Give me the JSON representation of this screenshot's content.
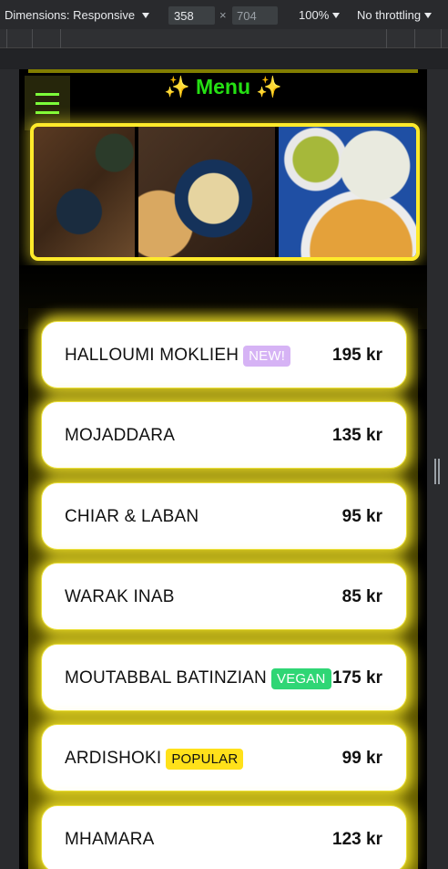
{
  "devtools": {
    "dimensions_label": "Dimensions: Responsive",
    "width_value": "358",
    "height_value": "704",
    "times": "×",
    "zoom": "100%",
    "throttling": "No throttling"
  },
  "page": {
    "title_left_sparkle": "✨",
    "title": "Menu",
    "title_right_sparkle": "✨"
  },
  "menu": {
    "items": [
      {
        "name": "HALLOUMI MOKLIEH",
        "badge": "NEW!",
        "price": "195 kr"
      },
      {
        "name": "MOJADDARA",
        "price": "135 kr"
      },
      {
        "name": "CHIAR & LABAN",
        "price": "95 kr"
      },
      {
        "name": "WARAK INAB",
        "price": "85 kr"
      },
      {
        "name": "MOUTABBAL BATINZIAN",
        "badge": "VEGAN",
        "price": "175 kr"
      },
      {
        "name": "ARDISHOKI",
        "badge": "POPULAR",
        "price": "99 kr"
      },
      {
        "name": "MHAMARA",
        "price": "123 kr"
      }
    ]
  },
  "colors": {
    "accent_yellow": "#ffea2b",
    "title_green": "#25e013",
    "badge_new": "#d6b3f5",
    "badge_vegan": "#2fd675",
    "badge_popular": "#ffe11a"
  }
}
